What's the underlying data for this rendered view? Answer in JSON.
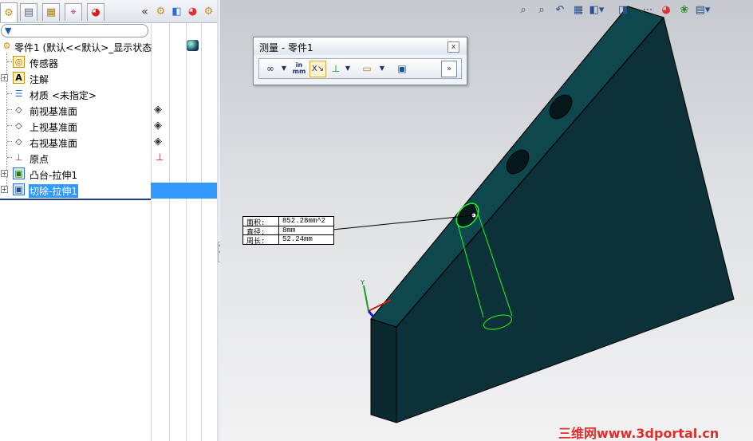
{
  "tabs": [
    {
      "icon": "featuremanager-tab-icon"
    },
    {
      "icon": "propertymanager-tab-icon"
    },
    {
      "icon": "configurationmanager-tab-icon"
    },
    {
      "icon": "dimxpert-tab-icon"
    },
    {
      "icon": "display-manager-tab-icon"
    }
  ],
  "collapse_label": "«",
  "tree": {
    "root_label": "零件1 (默认<<默认>_显示状态",
    "items": [
      {
        "label": "传感器",
        "icon": "sensor-icon"
      },
      {
        "label": "注解",
        "icon": "annotation-icon"
      },
      {
        "label": "材质 <未指定>",
        "icon": "material-icon"
      },
      {
        "label": "前视基准面",
        "icon": "plane-icon"
      },
      {
        "label": "上视基准面",
        "icon": "plane-icon"
      },
      {
        "label": "右视基准面",
        "icon": "plane-icon"
      },
      {
        "label": "原点",
        "icon": "origin-icon"
      },
      {
        "label": "凸台-拉伸1",
        "icon": "extrude-boss-icon"
      },
      {
        "label": "切除-拉伸1",
        "icon": "extrude-cut-icon",
        "selected": true
      }
    ]
  },
  "measure_dialog": {
    "title": "测量 - 零件1",
    "close_glyph": "x",
    "units_label_top": "in",
    "units_label_bottom": "mm"
  },
  "measure_results": [
    {
      "label": "面积:",
      "value": "852.28mm^2"
    },
    {
      "label": "直径:",
      "value": "8mm"
    },
    {
      "label": "周长:",
      "value": "52.24mm"
    }
  ],
  "triad": {
    "y_label": "Y"
  },
  "watermark": "三维网www.3dportal.cn",
  "colors": {
    "part_face": "#0f3a40",
    "part_edge": "#000000",
    "selection_highlight": "#00ff00",
    "tree_selection": "#3399ff"
  }
}
